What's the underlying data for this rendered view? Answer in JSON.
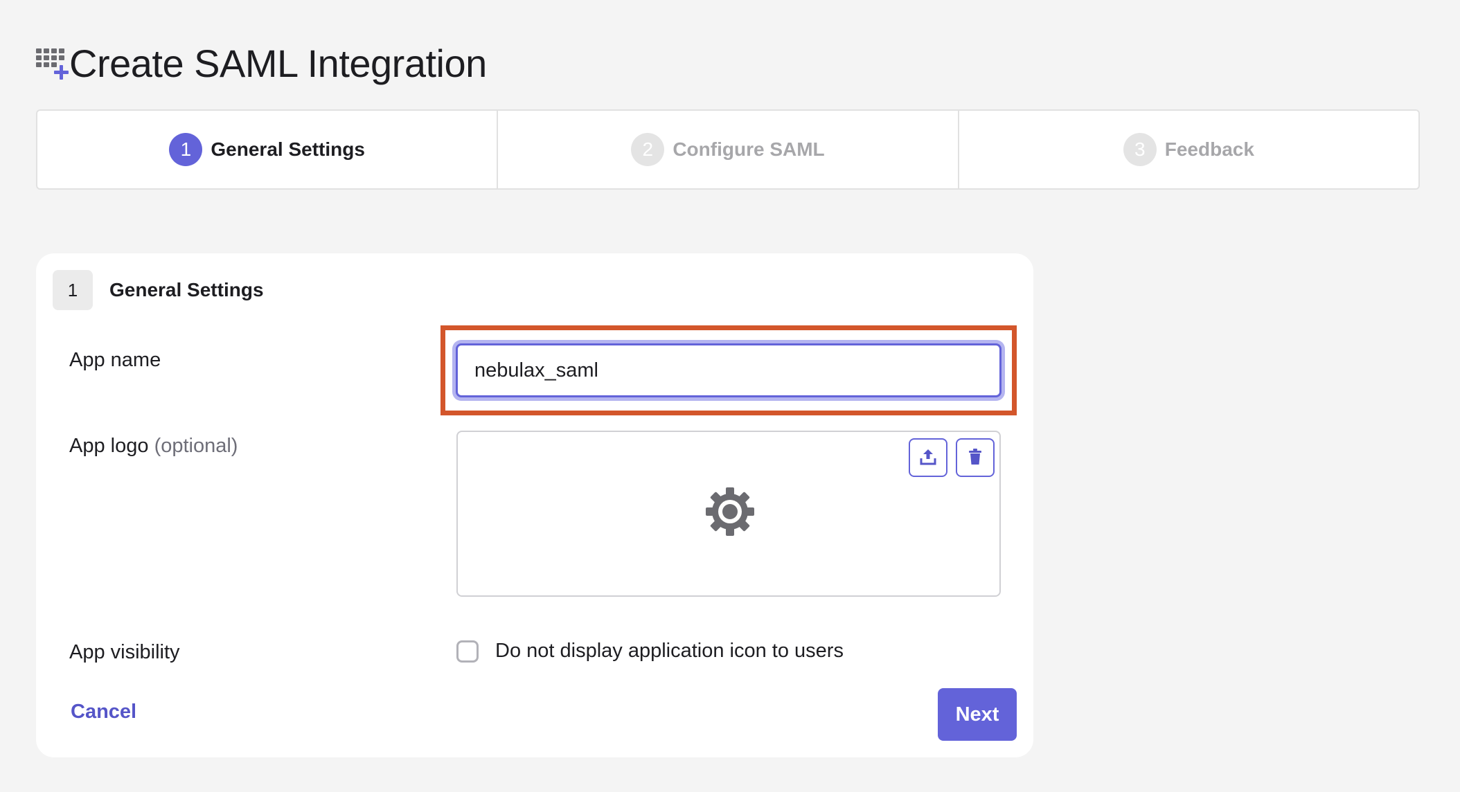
{
  "page": {
    "title": "Create SAML Integration",
    "title_icon": "grid-plus-icon"
  },
  "stepper": {
    "steps": [
      {
        "number": "1",
        "label": "General Settings",
        "state": "active"
      },
      {
        "number": "2",
        "label": "Configure SAML",
        "state": "inactive"
      },
      {
        "number": "3",
        "label": "Feedback",
        "state": "inactive"
      }
    ]
  },
  "section": {
    "number": "1",
    "title": "General Settings"
  },
  "form": {
    "app_name": {
      "label": "App name",
      "value": "nebulax_saml"
    },
    "app_logo": {
      "label": "App logo",
      "optional": "(optional)",
      "upload_icon": "upload-icon",
      "delete_icon": "trash-icon",
      "placeholder_icon": "gear-icon"
    },
    "app_visibility": {
      "label": "App visibility",
      "checkbox_label": "Do not display application icon to users",
      "checked": false
    }
  },
  "actions": {
    "cancel_label": "Cancel",
    "next_label": "Next"
  },
  "colors": {
    "accent": "#6363d9",
    "highlight": "#d3562b",
    "background": "#f4f4f4"
  }
}
